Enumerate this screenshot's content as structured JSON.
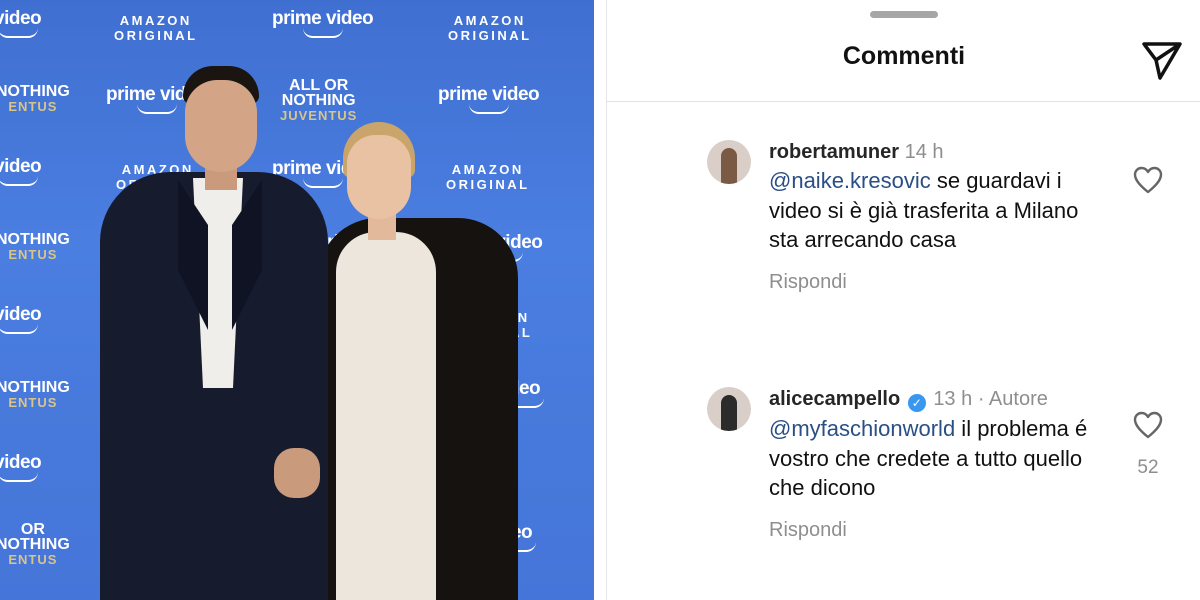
{
  "photo": {
    "backdrop": {
      "amazon_original": "AMAZON\nORIGINAL",
      "prime_video": "prime video",
      "all_or_nothing_top": "ALL OR",
      "all_or_nothing_mid": "NOTHING",
      "all_or_nothing_juv": "JUVENTUS",
      "fragment_video": "video",
      "fragment_nothing": "NOTHING",
      "fragment_ntus": "ENTUS",
      "fragment_or": "OR",
      "fragment_me_video": "me video",
      "fragment_zon": "ZON\nINAL",
      "fragment_prim": "prim",
      "fragment_o": "o",
      "fragment_deo": "deo"
    },
    "colors": {
      "backdrop_blue": "#4a7ee0",
      "suit": "#161b2e",
      "dress": "#ece6dc",
      "coat": "#15120f"
    }
  },
  "panel": {
    "title": "Commenti",
    "share_icon": "paper-plane-icon",
    "comments": [
      {
        "username": "robertamuner",
        "time": "14 h",
        "author_tag": "",
        "mention": "@naike.kresovic",
        "text_after_mention": " se guardavi i video si è  già trasferita a Milano sta arrecando casa",
        "reply_label": "Rispondi",
        "like_count": ""
      },
      {
        "username": "alicecampello",
        "verified_icon": "verified-badge-icon",
        "time": "13 h",
        "author_tag": "· Autore",
        "mention": "@myfaschionworld",
        "text_after_mention": " il problema é vostro che credete a tutto quello che dicono",
        "reply_label": "Rispondi",
        "like_count": "52"
      }
    ],
    "colors": {
      "mention": "#2a4f86",
      "secondary_text": "#8e8e8e",
      "verified": "#3897f0"
    }
  }
}
